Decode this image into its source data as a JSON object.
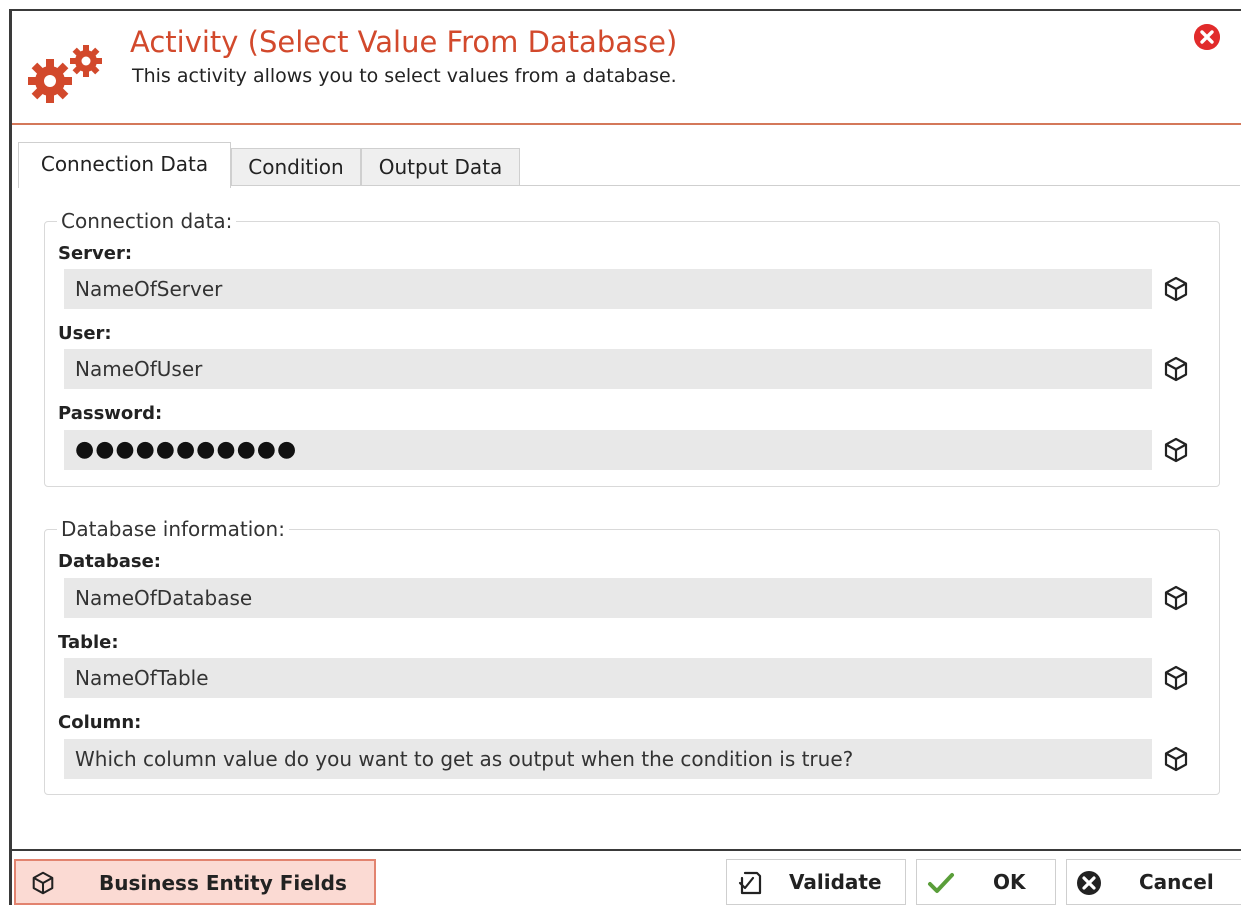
{
  "dialog": {
    "title": "Activity (Select Value From Database)",
    "subtitle": "This activity allows you to select values from a database."
  },
  "tabs": [
    {
      "label": "Connection Data",
      "active": true
    },
    {
      "label": "Condition",
      "active": false
    },
    {
      "label": "Output Data",
      "active": false
    }
  ],
  "connection": {
    "group_title": "Connection data:",
    "fields": [
      {
        "label": "Server:",
        "value": "NameOfServer"
      },
      {
        "label": "User:",
        "value": "NameOfUser"
      },
      {
        "label": "Password:",
        "value": "●●●●●●●●●●●"
      }
    ]
  },
  "database": {
    "group_title": "Database information:",
    "fields": [
      {
        "label": "Database:",
        "value": "NameOfDatabase"
      },
      {
        "label": "Table:",
        "value": "NameOfTable"
      },
      {
        "label": "Column:",
        "value": "Which column value do you want to get as output when the condition is true?"
      }
    ]
  },
  "footer": {
    "business_entity_label": "Business Entity Fields",
    "validate_label": "Validate",
    "ok_label": "OK",
    "cancel_label": "Cancel"
  },
  "colors": {
    "accent": "#d2492c",
    "close": "#e12b2b",
    "ok_check": "#5a9e3a",
    "bef_bg": "#fbdad3"
  },
  "icons": [
    "gears-icon",
    "close-icon",
    "cube-icon",
    "validate-icon",
    "check-icon",
    "cancel-icon"
  ]
}
